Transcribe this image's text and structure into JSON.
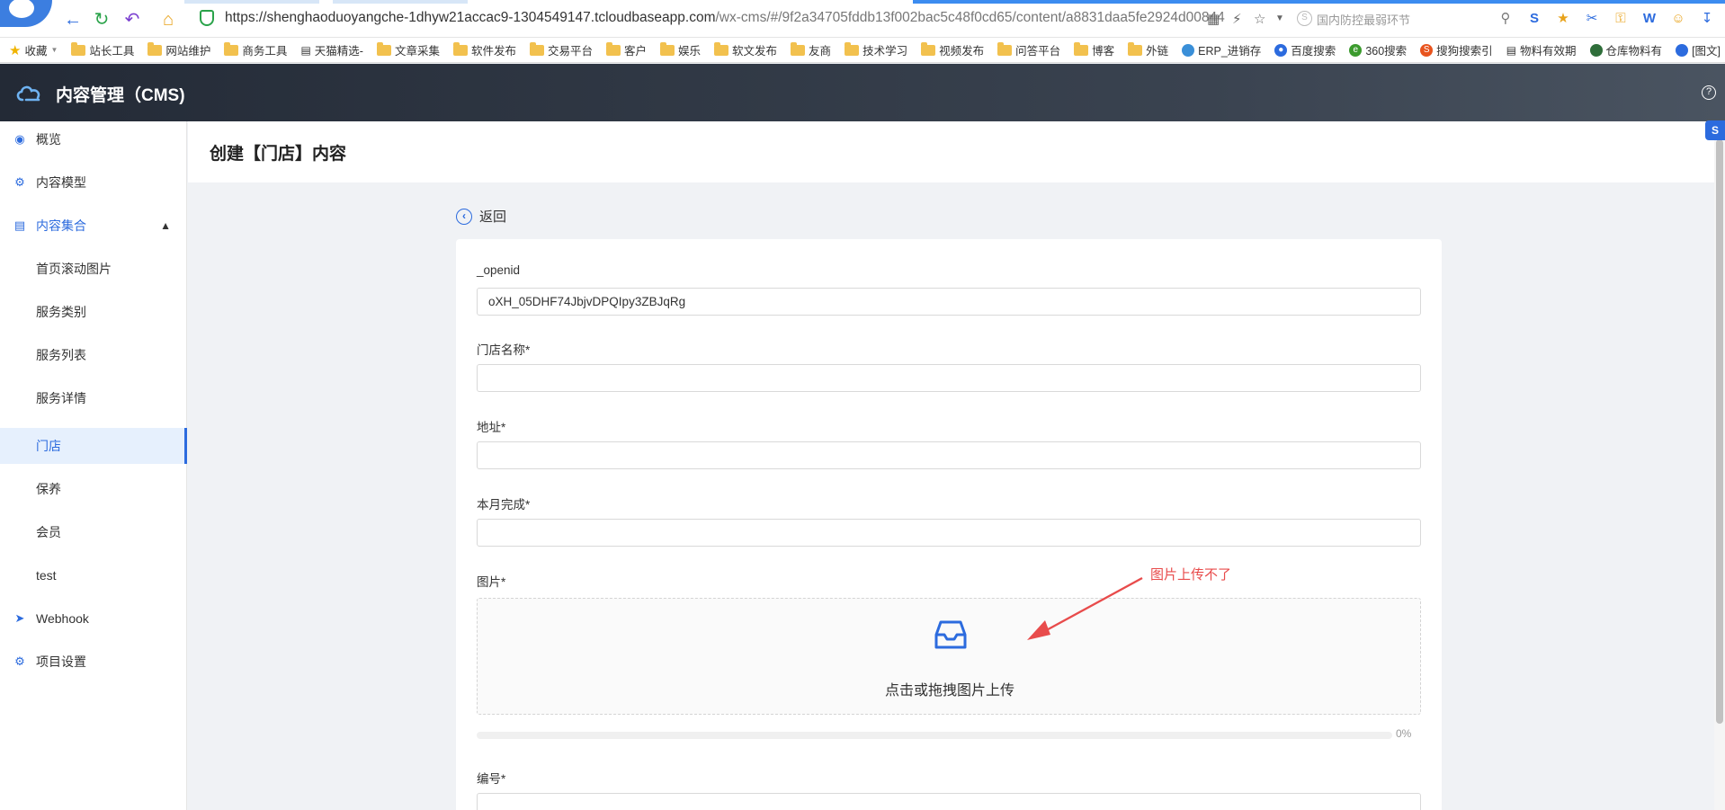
{
  "browser": {
    "url_host": "https://shenghaoduoyangche-1dhyw21accac9-1304549147.tcloudbaseapp.com",
    "url_path": "/wx-cms/#/9f2a34705fddb13f002bac5c48f0cd65/content/a8831daa5fe2924d00844",
    "search_placeholder": "国内防控最弱环节",
    "bookmarks_label": "收藏",
    "bookmarks": [
      "站长工具",
      "网站维护",
      "商务工具",
      "天猫精选-",
      "文章采集",
      "软件发布",
      "交易平台",
      "客户",
      "娱乐",
      "软文发布",
      "友商",
      "技术学习",
      "视频发布",
      "问答平台",
      "博客",
      "外链",
      "ERP_进销存",
      "百度搜索",
      "360搜索",
      "搜狗搜索引",
      "物料有效期",
      "仓库物料有",
      "[图文]"
    ]
  },
  "app": {
    "title": "内容管理（CMS)"
  },
  "sidebar": {
    "items": [
      {
        "label": "概览",
        "icon": "eye-icon"
      },
      {
        "label": "内容模型",
        "icon": "sitemap-icon"
      },
      {
        "label": "内容集合",
        "icon": "list-icon"
      },
      {
        "label": "首页滚动图片"
      },
      {
        "label": "服务类别"
      },
      {
        "label": "服务列表"
      },
      {
        "label": "服务详情"
      },
      {
        "label": "门店"
      },
      {
        "label": "保养"
      },
      {
        "label": "会员"
      },
      {
        "label": "test"
      },
      {
        "label": "Webhook",
        "icon": "rocket-icon"
      },
      {
        "label": "项目设置",
        "icon": "gear-icon"
      }
    ]
  },
  "page": {
    "title": "创建【门店】内容",
    "back_label": "返回"
  },
  "form": {
    "openid_label": "_openid",
    "openid_value": "oXH_05DHF74JbjvDPQIpy3ZBJqRg",
    "store_name_label": "门店名称*",
    "address_label": "地址*",
    "month_done_label": "本月完成*",
    "image_label": "图片*",
    "upload_text": "点击或拖拽图片上传",
    "progress_text": "0%",
    "progress_value": 0,
    "number_label": "编号*"
  },
  "annotation": {
    "text": "图片上传不了",
    "color": "#e84b4b"
  },
  "colors": {
    "accent": "#2c6bde"
  }
}
